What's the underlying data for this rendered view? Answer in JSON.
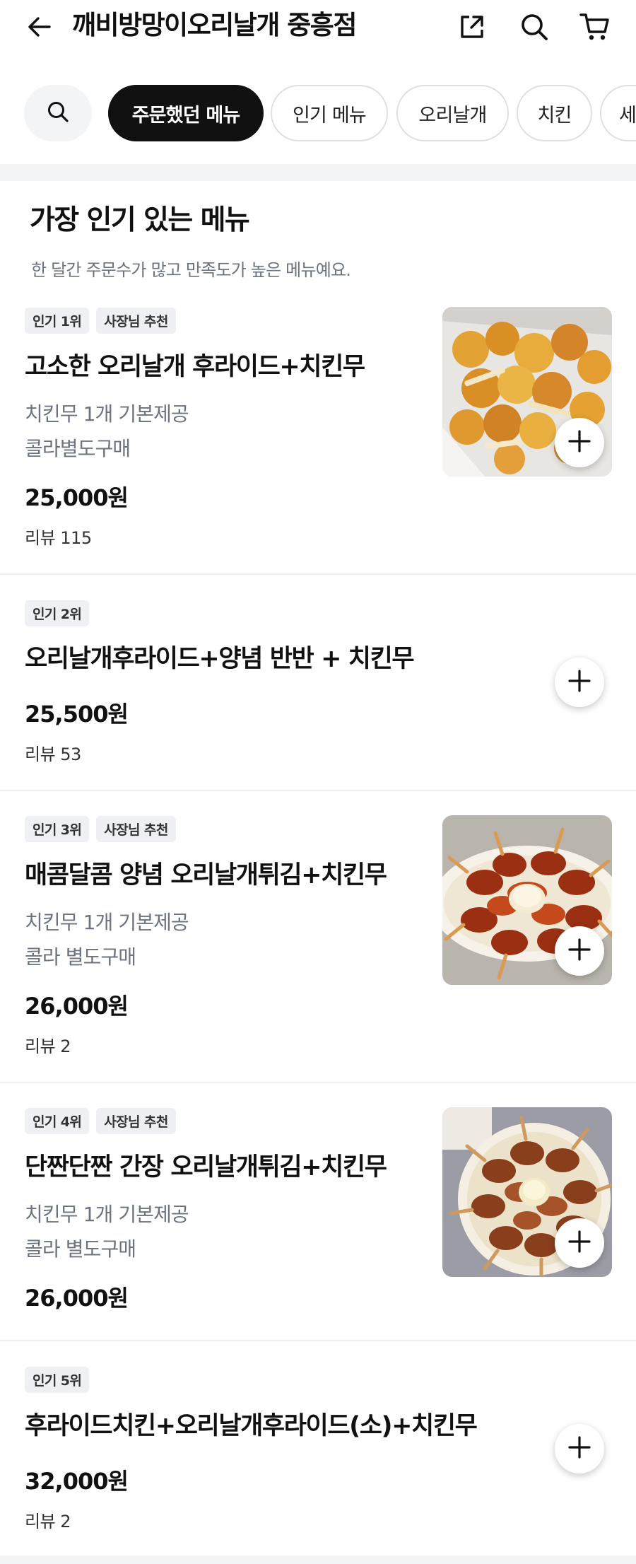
{
  "header": {
    "title": "깨비방망이오리날개 중흥점",
    "icons": [
      "back-arrow-icon",
      "share-icon",
      "search-icon",
      "cart-icon"
    ]
  },
  "categories": {
    "search_icon": "search-icon",
    "chips": [
      {
        "label": "주문했던 메뉴",
        "active": true
      },
      {
        "label": "인기 메뉴",
        "active": false
      },
      {
        "label": "오리날개",
        "active": false
      },
      {
        "label": "치킨",
        "active": false
      },
      {
        "label": "세",
        "active": false
      }
    ]
  },
  "section": {
    "title": "가장 인기 있는 메뉴",
    "subtitle": "한 달간 주문수가 많고 만족도가 높은 메뉴예요."
  },
  "items": [
    {
      "badges": [
        "인기 1위",
        "사장님 추천"
      ],
      "name": "고소한 오리날개 후라이드+치킨무",
      "desc1": "치킨무 1개 기본제공",
      "desc2": "콜라별도구매",
      "price": "25,000원",
      "review": "리뷰 115",
      "image": "fried-chicken-photo"
    },
    {
      "badges": [
        "인기 2위"
      ],
      "name": "오리날개후라이드+양념 반반 + 치킨무",
      "price": "25,500원",
      "review": "리뷰 53"
    },
    {
      "badges": [
        "인기 3위",
        "사장님 추천"
      ],
      "name": "매콤달콤 양념 오리날개튀김+치킨무",
      "desc1": "치킨무 1개 기본제공",
      "desc2": "콜라 별도구매",
      "price": "26,000원",
      "review": "리뷰 2",
      "image": "spicy-wings-plate-photo"
    },
    {
      "badges": [
        "인기 4위",
        "사장님 추천"
      ],
      "name": "단짠단짠 간장 오리날개튀김+치킨무",
      "desc1": "치킨무 1개 기본제공",
      "desc2": "콜라 별도구매",
      "price": "26,000원",
      "image": "soy-wings-plate-photo"
    },
    {
      "badges": [
        "인기 5위"
      ],
      "name": "후라이드치킨+오리날개후라이드(소)+치킨무",
      "price": "32,000원",
      "review": "리뷰 2"
    }
  ],
  "colors": {
    "active_chip": "#111111",
    "chip_border": "#dcdfe3",
    "muted_text": "#6b7280",
    "section_bg": "#f2f4f6",
    "badge_bg": "#eef0f3"
  }
}
